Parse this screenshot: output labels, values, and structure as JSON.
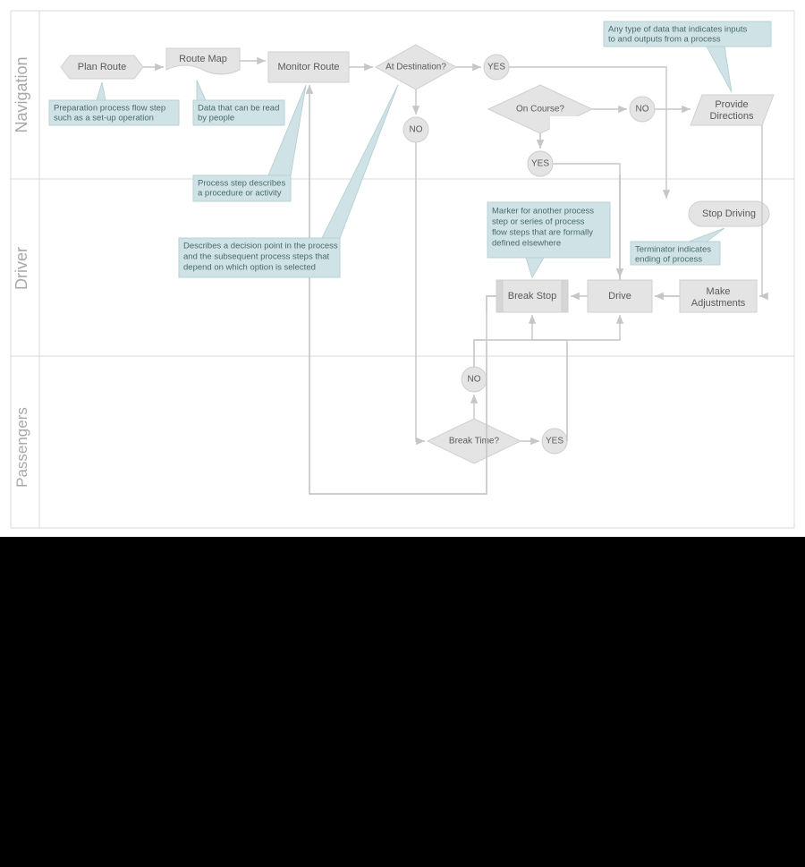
{
  "lanes": {
    "nav": "Navigation",
    "driver": "Driver",
    "pass": "Passengers"
  },
  "nodes": {
    "plan_route": "Plan Route",
    "route_map": "Route Map",
    "monitor_route": "Monitor Route",
    "at_destination": "At Destination?",
    "yes1": "YES",
    "no1": "NO",
    "on_course": "On Course?",
    "yes2": "YES",
    "no2": "NO",
    "provide_directions_l1": "Provide",
    "provide_directions_l2": "Directions",
    "stop_driving": "Stop Driving",
    "break_stop": "Break Stop",
    "drive": "Drive",
    "make_adj_l1": "Make",
    "make_adj_l2": "Adjustments",
    "break_time": "Break Time?",
    "yes3": "YES",
    "no3": "NO"
  },
  "annotations": {
    "prep_l1": "Preparation process flow step",
    "prep_l2": "such as a set-up operation",
    "data_l1": "Data that can be read",
    "data_l2": "by people",
    "process_l1": "Process step describes",
    "process_l2": "a procedure or activity",
    "decision_l1": "Describes a decision point in the process",
    "decision_l2": "and the subsequent process steps that",
    "decision_l3": "depend on which option is selected",
    "io_l1": "Any type of data that indicates inputs",
    "io_l2": "to and outputs from a process",
    "term_l1": "Terminator indicates",
    "term_l2": "ending of process",
    "sub_l1": "Marker for another process",
    "sub_l2": "step or series of process",
    "sub_l3": "flow steps that are formally",
    "sub_l4": "defined elsewhere"
  }
}
